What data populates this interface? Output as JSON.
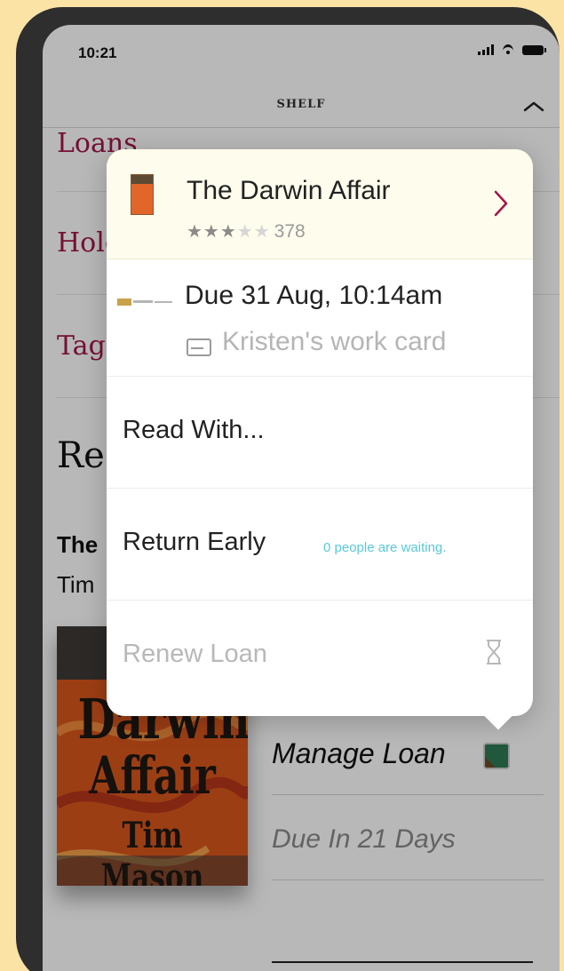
{
  "status_bar": {
    "time": "10:21"
  },
  "nav": {
    "title": "SHELF"
  },
  "menu": {
    "items": [
      {
        "label": "Loans"
      },
      {
        "label": "Holds"
      },
      {
        "label": "Tags"
      }
    ]
  },
  "section": {
    "title": "Re",
    "book_title_partial": "The",
    "book_author_partial": "Tim"
  },
  "book": {
    "cover_line_1": "Darwin",
    "cover_line_2": "Affair",
    "cover_line_3": "Tim Mason",
    "manage_label": "Manage Loan",
    "due_label": "Due In 21 Days"
  },
  "popover": {
    "title": "The Darwin Affair",
    "stars_filled": "★★★",
    "stars_empty": "★★",
    "rating_count": "378",
    "due": "Due 31 Aug, 10:14am",
    "card": "Kristen's work card",
    "actions": [
      {
        "label": "Read With..."
      },
      {
        "label": "Return Early",
        "note": "0 people are waiting."
      },
      {
        "label": "Renew Loan",
        "disabled": true
      }
    ]
  },
  "colors": {
    "background": "#fbe3a6",
    "accent": "#a3154a",
    "popover_header": "#fefcec",
    "waiting_text": "#5ac8d8"
  },
  "icons": [
    "signal-icon",
    "wifi-icon",
    "battery-icon",
    "chevron-up-icon",
    "chevron-right-icon",
    "card-icon",
    "hourglass-icon",
    "manage-loan-icon",
    "library-logo-icon"
  ]
}
